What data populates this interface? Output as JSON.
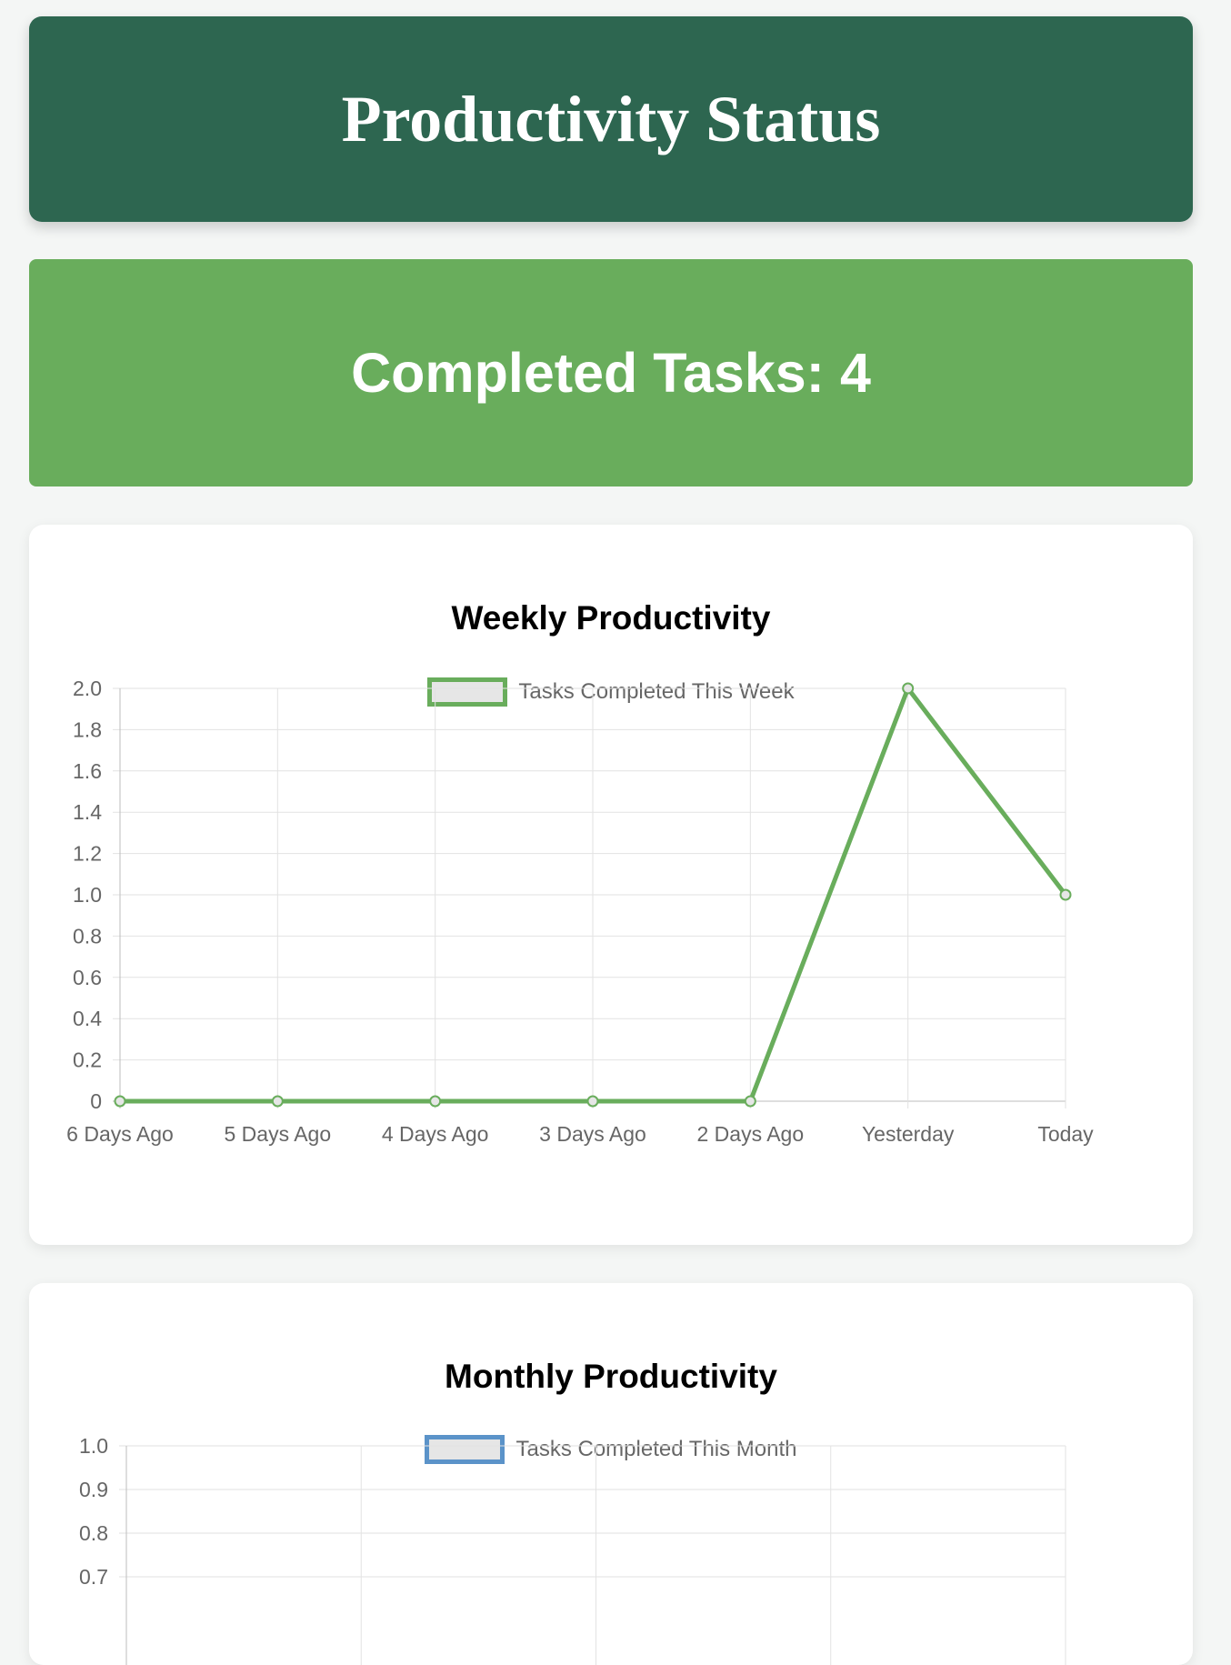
{
  "header": {
    "title": "Productivity Status"
  },
  "summary": {
    "completed_label": "Completed Tasks: 4"
  },
  "colors": {
    "header_bg": "#2d6650",
    "summary_bg": "#69ad5c",
    "weekly_line": "#69ad5c",
    "monthly_line": "#5b93c9",
    "grid": "#e2e2e2"
  },
  "chart_data": [
    {
      "type": "line",
      "title": "Weekly Productivity",
      "categories": [
        "6 Days Ago",
        "5 Days Ago",
        "4 Days Ago",
        "3 Days Ago",
        "2 Days Ago",
        "Yesterday",
        "Today"
      ],
      "series": [
        {
          "name": "Tasks Completed This Week",
          "values": [
            0,
            0,
            0,
            0,
            0,
            2,
            1
          ]
        }
      ],
      "ylim": [
        0,
        2
      ],
      "yticks": [
        "2.0",
        "1.8",
        "1.6",
        "1.4",
        "1.2",
        "1.0",
        "0.8",
        "0.6",
        "0.4",
        "0.2",
        "0"
      ],
      "grid": true,
      "legend": "top-center"
    },
    {
      "type": "line",
      "title": "Monthly Productivity",
      "series": [
        {
          "name": "Tasks Completed This Month",
          "values": []
        }
      ],
      "ylim": [
        0,
        1
      ],
      "yticks_visible": [
        "1.0",
        "0.9",
        "0.8",
        "0.7"
      ],
      "grid": true,
      "legend": "top-center"
    }
  ]
}
